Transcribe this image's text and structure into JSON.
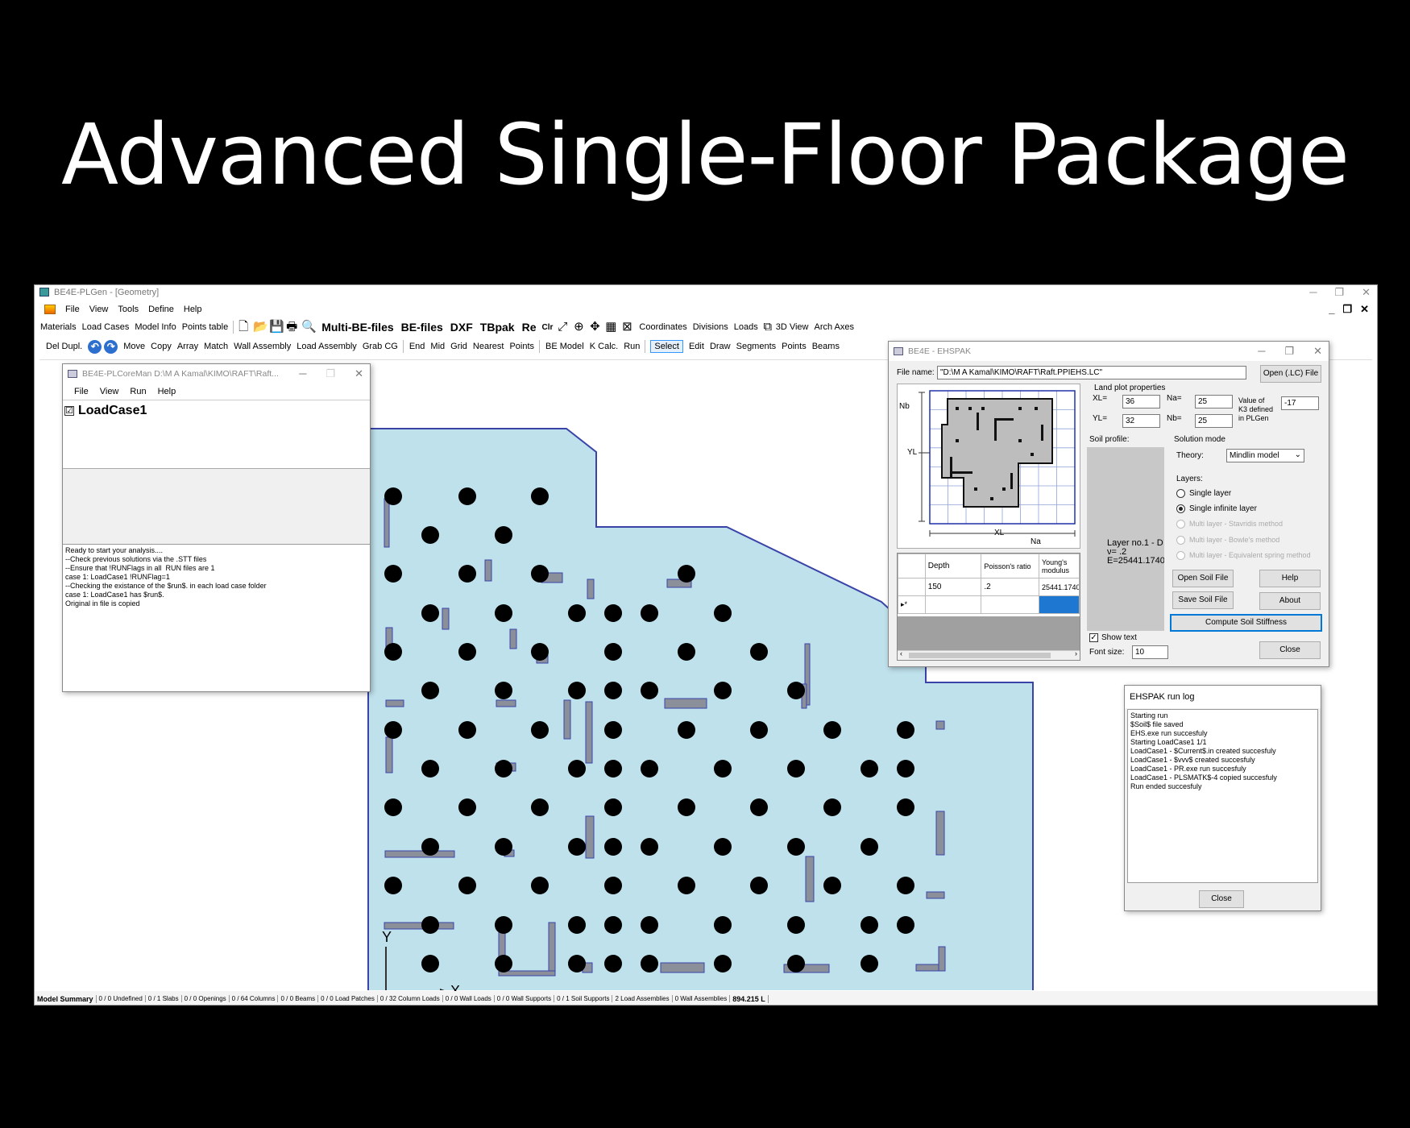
{
  "banner": {
    "title": "Advanced Single-Floor Package"
  },
  "main_window": {
    "title": "BE4E-PLGen - [Geometry]",
    "controls": [
      "─",
      "❐",
      "✕"
    ],
    "mdi_controls": [
      "_",
      "❐",
      "✕"
    ],
    "menu": [
      "File",
      "View",
      "Tools",
      "Define",
      "Help"
    ],
    "toolbar1": {
      "left": [
        "Materials",
        "Load Cases",
        "Model Info",
        "Points table"
      ],
      "big": [
        "Multi-BE-files",
        "BE-files",
        "DXF",
        "TBpak",
        "Re"
      ],
      "clr": "Clr",
      "right": [
        "Coordinates",
        "Divisions",
        "Loads",
        "3D View",
        "Arch Axes"
      ]
    },
    "toolbar2": {
      "del_dupl": "Del Dupl.",
      "edit_tools": [
        "Move",
        "Copy",
        "Array",
        "Match",
        "Wall Assembly",
        "Load Assembly",
        "Grab CG"
      ],
      "snap_tools": [
        "End",
        "Mid",
        "Grid",
        "Nearest",
        "Points"
      ],
      "run_tools": [
        "BE Model",
        "K Calc.",
        "Run"
      ],
      "select": "Select",
      "draw_tools": [
        "Edit",
        "Draw",
        "Segments",
        "Points",
        "Beams"
      ]
    },
    "axes": {
      "x": "X",
      "y": "Y"
    },
    "status": [
      "Model Summary",
      "0 / 0 Undefined",
      "0 / 1 Slabs",
      "0 / 0 Openings",
      "0 / 64 Columns",
      "0 / 0 Beams",
      "0 / 0 Load Patches",
      "0 / 32 Column Loads",
      "0 / 0 Wall Loads",
      "0 / 0 Wall Supports",
      "0 / 1 Soil Supports",
      "2 Load Assemblies",
      "0 Wall Assemblies",
      "894.215 L"
    ]
  },
  "coreman": {
    "title": "BE4E-PLCoreMan D:\\M A Kamal\\KIMO\\RAFT\\Raft...",
    "menu": [
      "File",
      "View",
      "Run",
      "Help"
    ],
    "loadcase": "LoadCase1",
    "loadcase_check": "☑",
    "log": "Ready to start your analysis....\n--Check previous solutions via the .STT files\n--Ensure that !RUNFlags in all  RUN files are 1\ncase 1: LoadCase1 !RUNFlag=1\n--Checking the existance of the $run$. in each load case folder\ncase 1: LoadCase1 has $run$.\nOriginal in file is copied"
  },
  "ehspak": {
    "title": "BE4E - EHSPAK",
    "file_label": "File name:",
    "file_value": "\"D:\\M A Kamal\\KIMO\\RAFT\\Raft.PPIEHS.LC\"",
    "open_lc": "Open (.LC) File",
    "plot_labels": {
      "nb": "Nb",
      "yl": "YL",
      "xl": "XL",
      "na": "Na"
    },
    "land_plot": "Land plot properties",
    "xl_label": "XL=",
    "xl": "36",
    "yl_label": "YL=",
    "yl": "32",
    "na_label": "Na=",
    "na": "25",
    "nb_label": "Nb=",
    "nb": "25",
    "k3_label1": "Value of",
    "k3_label2": "K3 defined",
    "k3_label3": "in PLGen",
    "k3": "-17",
    "soil_profile": "Soil profile:",
    "profile_text": "Layer no.1 - D\nν= .2\nE=25441.1740",
    "solution_mode": "Solution mode",
    "theory_label": "Theory:",
    "theory": "Mindlin model",
    "layers_label": "Layers:",
    "layers": [
      "Single layer",
      "Single infinite layer",
      "Multi layer - Stavridis method",
      "Multi layer - Bowle's method",
      "Multi layer - Equivalent spring method"
    ],
    "table_headers": [
      "Depth",
      "Poisson's ratio",
      "Young's modulus"
    ],
    "table_row": [
      "150",
      ".2",
      "25441.1740"
    ],
    "new_row_marker": "▸*",
    "buttons": {
      "open_soil": "Open Soil File",
      "help": "Help",
      "save_soil": "Save Soil File",
      "about": "About",
      "compute": "Compute Soil Stiffness",
      "close": "Close"
    },
    "show_text": "Show text",
    "font_size_label": "Font size:",
    "font_size": "10"
  },
  "runlog": {
    "title": "EHSPAK run log",
    "log": "Starting run\n$Soil$ file saved\nEHS.exe run succesfuly\nStarting LoadCase1 1/1\nLoadCase1 - $Current$.in created succesfuly\nLoadCase1 - $vvv$ created succesfuly\nLoadCase1 - PR.exe run succesfuly\nLoadCase1 - PLSMATK$-4 copied succesfuly\nRun ended succesfuly",
    "close": "Close"
  },
  "colors": {
    "slab": "#bfe1ec",
    "slab_edge": "#3a44a8",
    "column": "#000000",
    "wall": "#8a8f9a"
  }
}
